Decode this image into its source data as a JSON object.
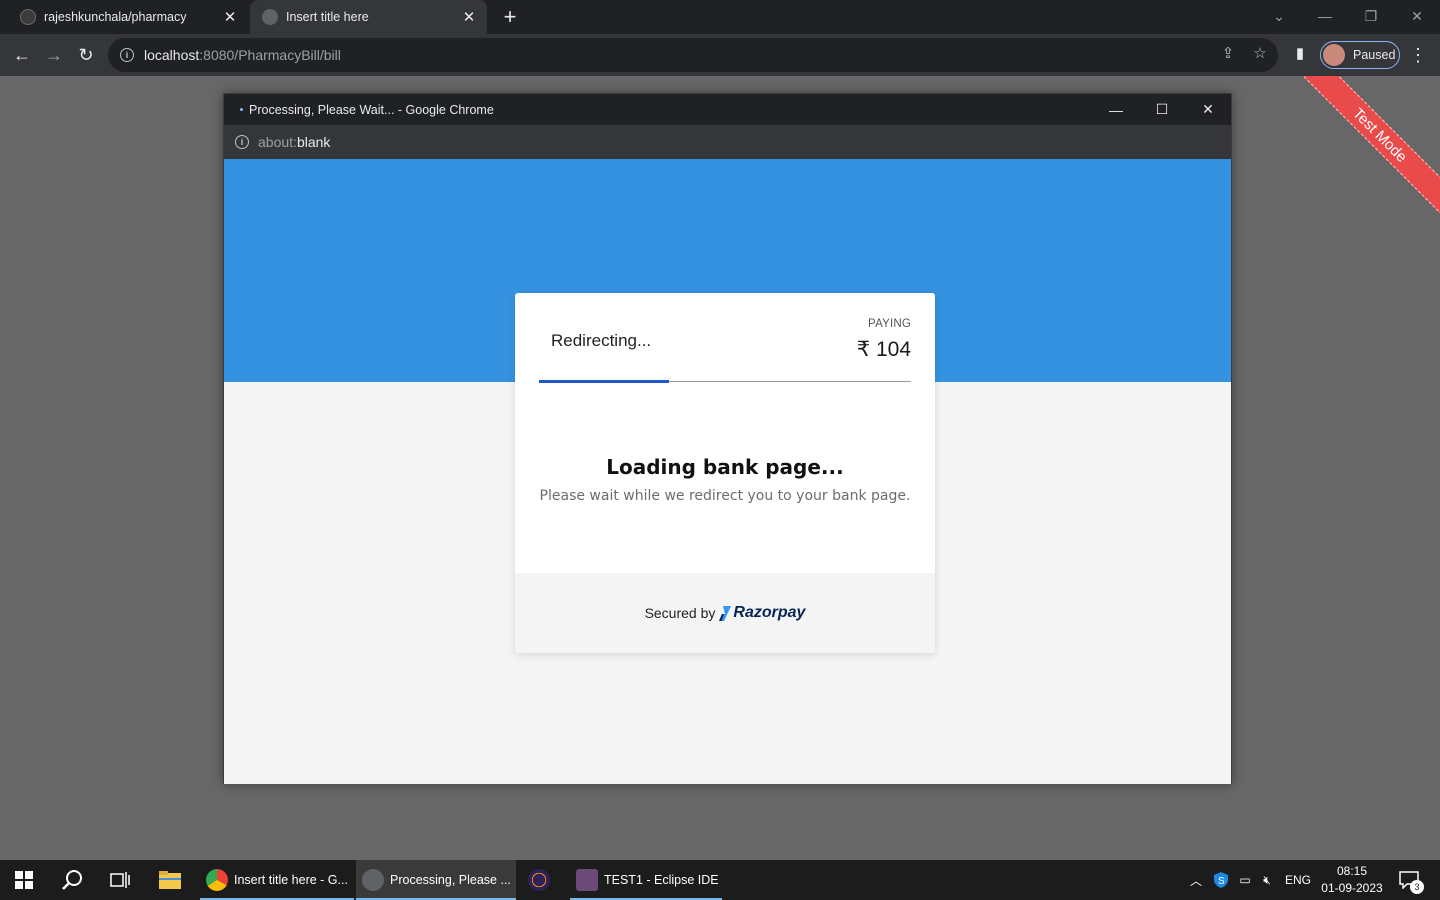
{
  "browser": {
    "tabs": [
      {
        "title": "rajeshkunchala/pharmacy"
      },
      {
        "title": "Insert title here"
      }
    ],
    "url_host": "localhost",
    "url_rest": ":8080/PharmacyBill/bill",
    "profile_label": "Paused"
  },
  "ribbon": {
    "label": "Test Mode"
  },
  "popup": {
    "window_title": "Processing, Please Wait... - Google Chrome",
    "address_scheme": "about:",
    "address_rest": "blank"
  },
  "checkout": {
    "status_text": "Redirecting...",
    "paying_label": "PAYING",
    "amount": "₹ 104",
    "progress_fraction": 0.35,
    "loading_title": "Loading bank page...",
    "loading_subtitle": "Please wait while we redirect you to your bank page.",
    "secured_by": "Secured by",
    "brand": "Razorpay",
    "brand_color": "#072654",
    "accent_color": "#3592e0"
  },
  "taskbar": {
    "apps": [
      {
        "label": "Insert title here - G..."
      },
      {
        "label": "Processing, Please ..."
      },
      {
        "label": ""
      },
      {
        "label": "TEST1 - Eclipse IDE"
      }
    ],
    "language": "ENG",
    "time": "08:15",
    "date": "01-09-2023",
    "notification_count": "3"
  }
}
